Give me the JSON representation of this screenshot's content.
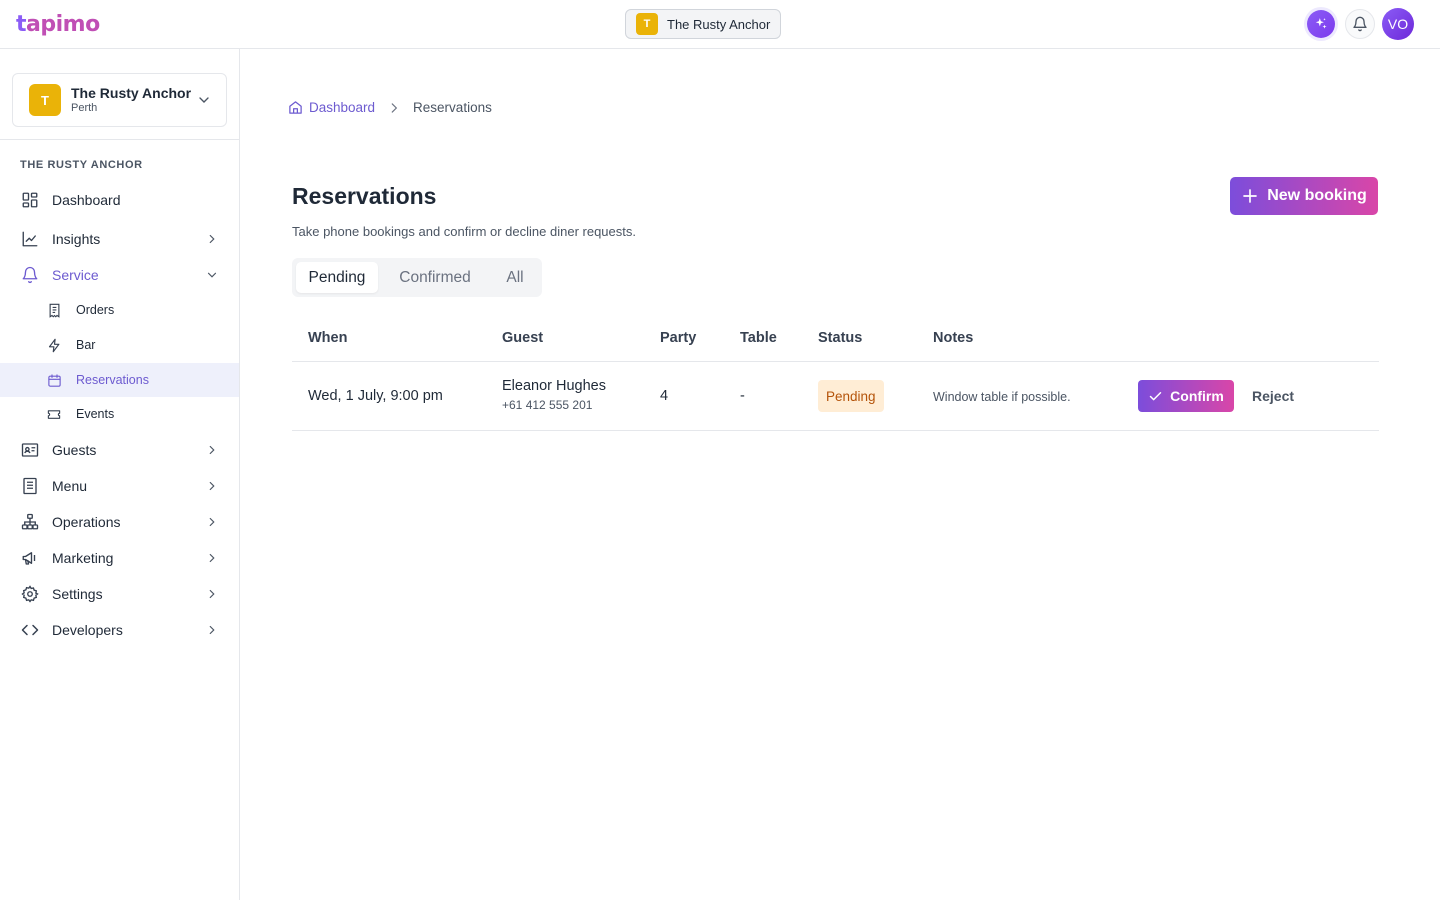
{
  "app": {
    "logo_text": "tapimo",
    "logo_first": "t",
    "logo_rest": "apimo"
  },
  "topbar": {
    "venue_initial": "T",
    "venue_name": "The Rusty Anchor",
    "avatar_initials": "VO",
    "icons": [
      "sparkle-icon",
      "bell-icon"
    ]
  },
  "sidebar": {
    "venue": {
      "initial": "T",
      "name": "The Rusty Anchor",
      "city": "Perth"
    },
    "section_label": "THE RUSTY ANCHOR",
    "items": [
      {
        "label": "Dashboard",
        "icon": "dashboard-icon"
      },
      {
        "label": "Insights",
        "icon": "chart-icon"
      },
      {
        "label": "Service",
        "icon": "bell-icon"
      },
      {
        "label": "Guests",
        "icon": "id-card-icon"
      },
      {
        "label": "Menu",
        "icon": "menu-icon"
      },
      {
        "label": "Operations",
        "icon": "sitemap-icon"
      },
      {
        "label": "Marketing",
        "icon": "megaphone-icon"
      },
      {
        "label": "Settings",
        "icon": "gear-icon"
      },
      {
        "label": "Developers",
        "icon": "code-icon"
      }
    ],
    "service_subitems": [
      {
        "label": "Orders",
        "icon": "receipt-icon"
      },
      {
        "label": "Bar",
        "icon": "bolt-icon"
      },
      {
        "label": "Reservations",
        "icon": "calendar-icon"
      },
      {
        "label": "Events",
        "icon": "ticket-icon"
      }
    ],
    "accent_color": "#6d5bd0"
  },
  "breadcrumb": {
    "home": "Dashboard",
    "current": "Reservations"
  },
  "page": {
    "title": "Reservations",
    "subtitle": "Take phone bookings and confirm or decline diner requests.",
    "new_button": "New booking"
  },
  "tabs": [
    {
      "label": "Pending",
      "active": true
    },
    {
      "label": "Confirmed",
      "active": false
    },
    {
      "label": "All",
      "active": false
    }
  ],
  "table": {
    "columns": [
      "When",
      "Guest",
      "Party",
      "Table",
      "Status",
      "Notes"
    ],
    "rows": [
      {
        "when": "Wed, 1 July, 9:00 pm",
        "guest_name": "Eleanor Hughes",
        "guest_phone": "+61 412 555 201",
        "party": "4",
        "table": "-",
        "status": "Pending",
        "notes": "Window table if possible.",
        "confirm_label": "Confirm",
        "reject_label": "Reject"
      }
    ]
  },
  "colors": {
    "brand_gradient_start": "#7c4ddb",
    "brand_gradient_end": "#d946a8",
    "pending_bg": "#ffedd5",
    "pending_text": "#b45309",
    "venue_badge": "#eab308"
  }
}
